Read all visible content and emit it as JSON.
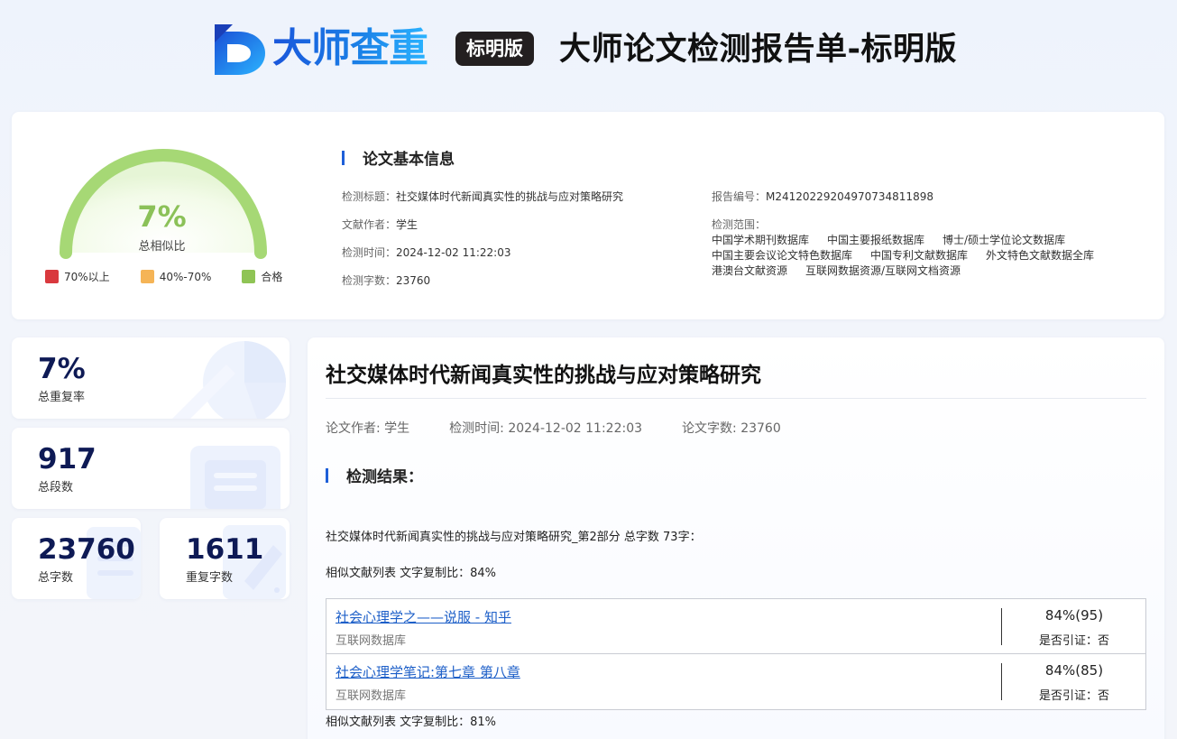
{
  "header": {
    "logo_text": "大师查重",
    "logo_badge": "标明版",
    "title": "大师论文检测报告单-标明版"
  },
  "gauge": {
    "percent": "7%",
    "label": "总相似比",
    "value_fraction": 0.07,
    "color": "#a6d875",
    "legend": [
      {
        "label": "70%以上",
        "color": "#d9393e"
      },
      {
        "label": "40%-70%",
        "color": "#f5b456"
      },
      {
        "label": "合格",
        "color": "#8fc455"
      }
    ]
  },
  "basic_info": {
    "heading": "论文基本信息",
    "title_label": "检测标题：",
    "title_value": "社交媒体时代新闻真实性的挑战与应对策略研究",
    "author_label": "文献作者：",
    "author_value": "学生",
    "time_label": "检测时间：",
    "time_value": "2024-12-02 11:22:03",
    "words_label": "检测字数：",
    "words_value": "23760",
    "report_no_label": "报告编号：",
    "report_no_value": "M24120229204970734811898",
    "scope_label": "检测范围：",
    "scope_lines": [
      [
        "中国学术期刊数据库",
        "中国主要报纸数据库",
        "博士/硕士学位论文数据库"
      ],
      [
        "中国主要会议论文特色数据库",
        "中国专利文献数据库",
        "外文特色文献数据全库"
      ],
      [
        "港澳台文献资源",
        "互联网数据资源/互联网文档资源"
      ]
    ]
  },
  "stats": {
    "total_rate": {
      "value": "7%",
      "label": "总重复率"
    },
    "total_paragraphs": {
      "value": "917",
      "label": "总段数"
    },
    "total_words": {
      "value": "23760",
      "label": "总字数"
    },
    "repeat_words": {
      "value": "1611",
      "label": "重复字数"
    }
  },
  "result": {
    "title": "社交媒体时代新闻真实性的挑战与应对策略研究",
    "author": "论文作者: 学生",
    "time": "检测时间: 2024-12-02 11:22:03",
    "words": "论文字数: 23760",
    "heading": "检测结果：",
    "part_line": "社交媒体时代新闻真实性的挑战与应对策略研究_第2部分 总字数 73字：",
    "ratio_line_1": "相似文献列表 文字复制比：84%",
    "ratio_line_2": "相似文献列表 文字复制比：81%",
    "docs": [
      {
        "title": "社会心理学之——说服 - 知乎",
        "source": "互联网数据库",
        "pct": "84%(95)",
        "cite": "是否引证：否"
      },
      {
        "title": "社会心理学笔记:第七章 第八章",
        "source": "互联网数据库",
        "pct": "84%(85)",
        "cite": "是否引证：否"
      }
    ]
  }
}
